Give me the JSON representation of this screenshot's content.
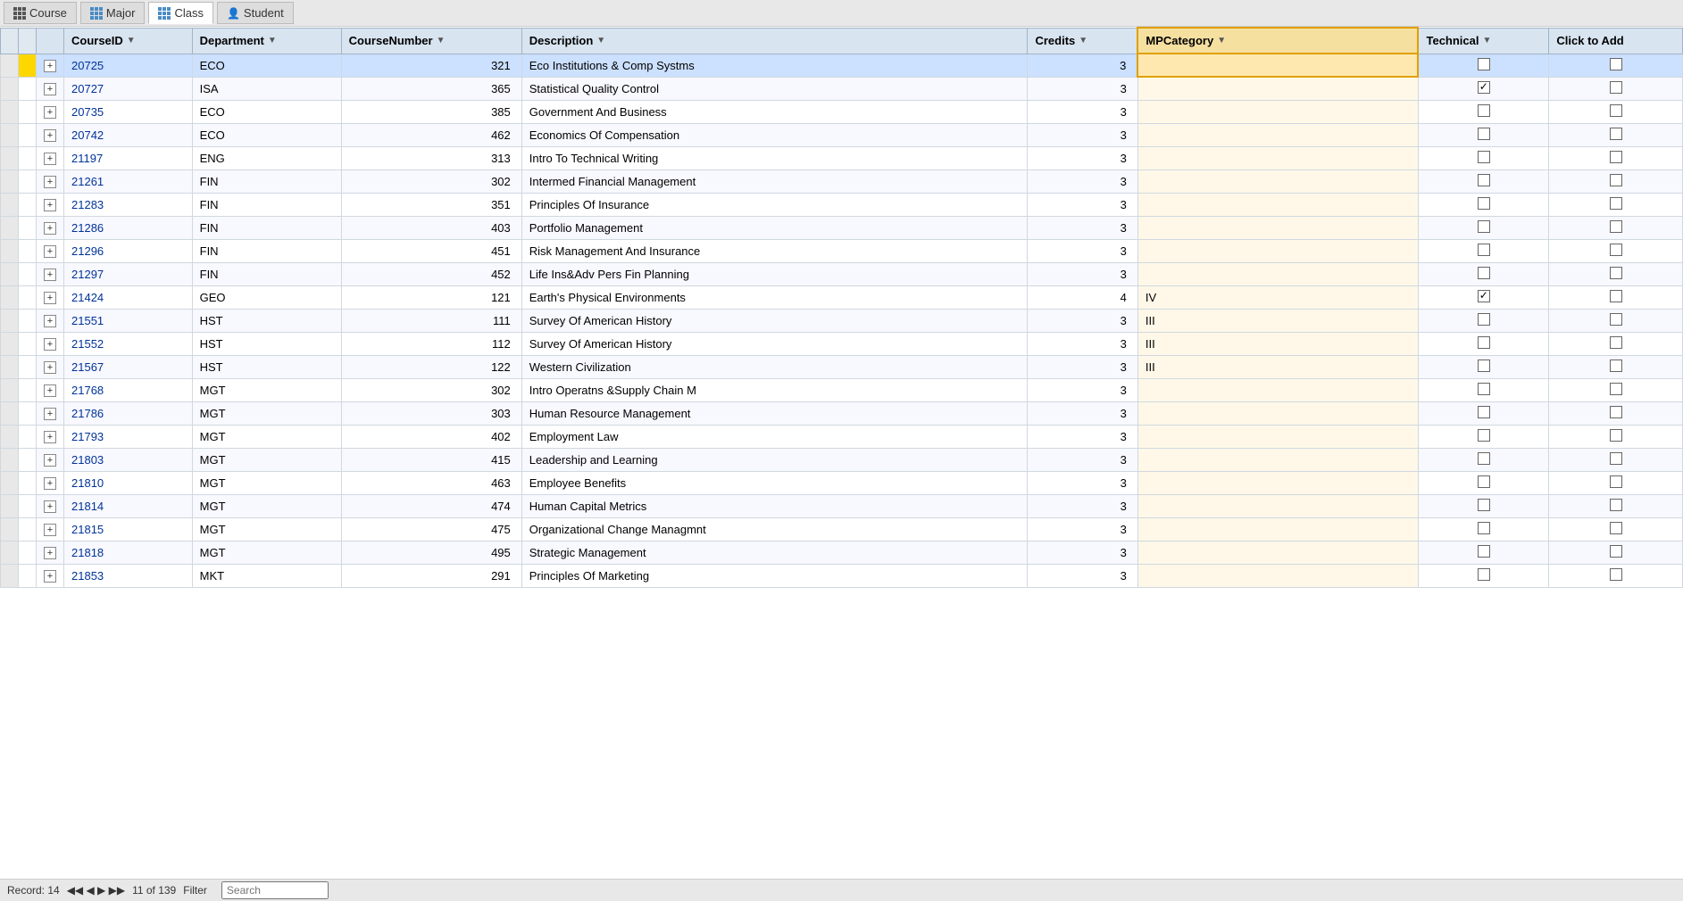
{
  "nav": {
    "tabs": [
      {
        "id": "course",
        "label": "Course",
        "active": false
      },
      {
        "id": "major",
        "label": "Major",
        "active": false
      },
      {
        "id": "class",
        "label": "Class",
        "active": true
      },
      {
        "id": "student",
        "label": "Student",
        "active": false
      }
    ]
  },
  "table": {
    "columns": [
      {
        "id": "expand",
        "label": "",
        "key": "expand"
      },
      {
        "id": "courseid",
        "label": "CourseID",
        "key": "courseID"
      },
      {
        "id": "department",
        "label": "Department",
        "key": "department"
      },
      {
        "id": "coursenumber",
        "label": "CourseNumber",
        "key": "courseNumber"
      },
      {
        "id": "description",
        "label": "Description",
        "key": "description"
      },
      {
        "id": "credits",
        "label": "Credits",
        "key": "credits"
      },
      {
        "id": "mpcategory",
        "label": "MPCategory",
        "key": "mpCategory"
      },
      {
        "id": "technical",
        "label": "Technical",
        "key": "technical"
      },
      {
        "id": "clicktoadd",
        "label": "Click to Add",
        "key": "clickToAdd"
      }
    ],
    "rows": [
      {
        "courseID": "20725",
        "department": "ECO",
        "courseNumber": "321",
        "description": "Eco Institutions & Comp Systms",
        "credits": "3",
        "mpCategory": "",
        "technical": false,
        "clickToAdd": false,
        "selected": true
      },
      {
        "courseID": "20727",
        "department": "ISA",
        "courseNumber": "365",
        "description": "Statistical Quality Control",
        "credits": "3",
        "mpCategory": "",
        "technical": true,
        "clickToAdd": false,
        "selected": false
      },
      {
        "courseID": "20735",
        "department": "ECO",
        "courseNumber": "385",
        "description": "Government And Business",
        "credits": "3",
        "mpCategory": "",
        "technical": false,
        "clickToAdd": false,
        "selected": false
      },
      {
        "courseID": "20742",
        "department": "ECO",
        "courseNumber": "462",
        "description": "Economics Of Compensation",
        "credits": "3",
        "mpCategory": "",
        "technical": false,
        "clickToAdd": false,
        "selected": false
      },
      {
        "courseID": "21197",
        "department": "ENG",
        "courseNumber": "313",
        "description": "Intro To Technical Writing",
        "credits": "3",
        "mpCategory": "",
        "technical": false,
        "clickToAdd": false,
        "selected": false
      },
      {
        "courseID": "21261",
        "department": "FIN",
        "courseNumber": "302",
        "description": "Intermed Financial Management",
        "credits": "3",
        "mpCategory": "",
        "technical": false,
        "clickToAdd": false,
        "selected": false
      },
      {
        "courseID": "21283",
        "department": "FIN",
        "courseNumber": "351",
        "description": "Principles Of Insurance",
        "credits": "3",
        "mpCategory": "",
        "technical": false,
        "clickToAdd": false,
        "selected": false
      },
      {
        "courseID": "21286",
        "department": "FIN",
        "courseNumber": "403",
        "description": "Portfolio Management",
        "credits": "3",
        "mpCategory": "",
        "technical": false,
        "clickToAdd": false,
        "selected": false
      },
      {
        "courseID": "21296",
        "department": "FIN",
        "courseNumber": "451",
        "description": "Risk Management And Insurance",
        "credits": "3",
        "mpCategory": "",
        "technical": false,
        "clickToAdd": false,
        "selected": false
      },
      {
        "courseID": "21297",
        "department": "FIN",
        "courseNumber": "452",
        "description": "Life Ins&Adv Pers Fin Planning",
        "credits": "3",
        "mpCategory": "",
        "technical": false,
        "clickToAdd": false,
        "selected": false
      },
      {
        "courseID": "21424",
        "department": "GEO",
        "courseNumber": "121",
        "description": "Earth's Physical Environments",
        "credits": "4",
        "mpCategory": "IV",
        "technical": true,
        "clickToAdd": false,
        "selected": false
      },
      {
        "courseID": "21551",
        "department": "HST",
        "courseNumber": "111",
        "description": "Survey Of American History",
        "credits": "3",
        "mpCategory": "III",
        "technical": false,
        "clickToAdd": false,
        "selected": false
      },
      {
        "courseID": "21552",
        "department": "HST",
        "courseNumber": "112",
        "description": "Survey Of American History",
        "credits": "3",
        "mpCategory": "III",
        "technical": false,
        "clickToAdd": false,
        "selected": false
      },
      {
        "courseID": "21567",
        "department": "HST",
        "courseNumber": "122",
        "description": "Western Civilization",
        "credits": "3",
        "mpCategory": "III",
        "technical": false,
        "clickToAdd": false,
        "selected": false
      },
      {
        "courseID": "21768",
        "department": "MGT",
        "courseNumber": "302",
        "description": "Intro Operatns &Supply Chain M",
        "credits": "3",
        "mpCategory": "",
        "technical": false,
        "clickToAdd": false,
        "selected": false
      },
      {
        "courseID": "21786",
        "department": "MGT",
        "courseNumber": "303",
        "description": "Human Resource Management",
        "credits": "3",
        "mpCategory": "",
        "technical": false,
        "clickToAdd": false,
        "selected": false
      },
      {
        "courseID": "21793",
        "department": "MGT",
        "courseNumber": "402",
        "description": "Employment Law",
        "credits": "3",
        "mpCategory": "",
        "technical": false,
        "clickToAdd": false,
        "selected": false
      },
      {
        "courseID": "21803",
        "department": "MGT",
        "courseNumber": "415",
        "description": "Leadership and Learning",
        "credits": "3",
        "mpCategory": "",
        "technical": false,
        "clickToAdd": false,
        "selected": false
      },
      {
        "courseID": "21810",
        "department": "MGT",
        "courseNumber": "463",
        "description": "Employee Benefits",
        "credits": "3",
        "mpCategory": "",
        "technical": false,
        "clickToAdd": false,
        "selected": false
      },
      {
        "courseID": "21814",
        "department": "MGT",
        "courseNumber": "474",
        "description": "Human Capital Metrics",
        "credits": "3",
        "mpCategory": "",
        "technical": false,
        "clickToAdd": false,
        "selected": false
      },
      {
        "courseID": "21815",
        "department": "MGT",
        "courseNumber": "475",
        "description": "Organizational Change Managmnt",
        "credits": "3",
        "mpCategory": "",
        "technical": false,
        "clickToAdd": false,
        "selected": false
      },
      {
        "courseID": "21818",
        "department": "MGT",
        "courseNumber": "495",
        "description": "Strategic Management",
        "credits": "3",
        "mpCategory": "",
        "technical": false,
        "clickToAdd": false,
        "selected": false
      },
      {
        "courseID": "21853",
        "department": "MKT",
        "courseNumber": "291",
        "description": "Principles Of Marketing",
        "credits": "3",
        "mpCategory": "",
        "technical": false,
        "clickToAdd": false,
        "selected": false
      }
    ]
  },
  "statusBar": {
    "record": "Record: 14",
    "of": "11 of 139",
    "filter": "Filter"
  }
}
